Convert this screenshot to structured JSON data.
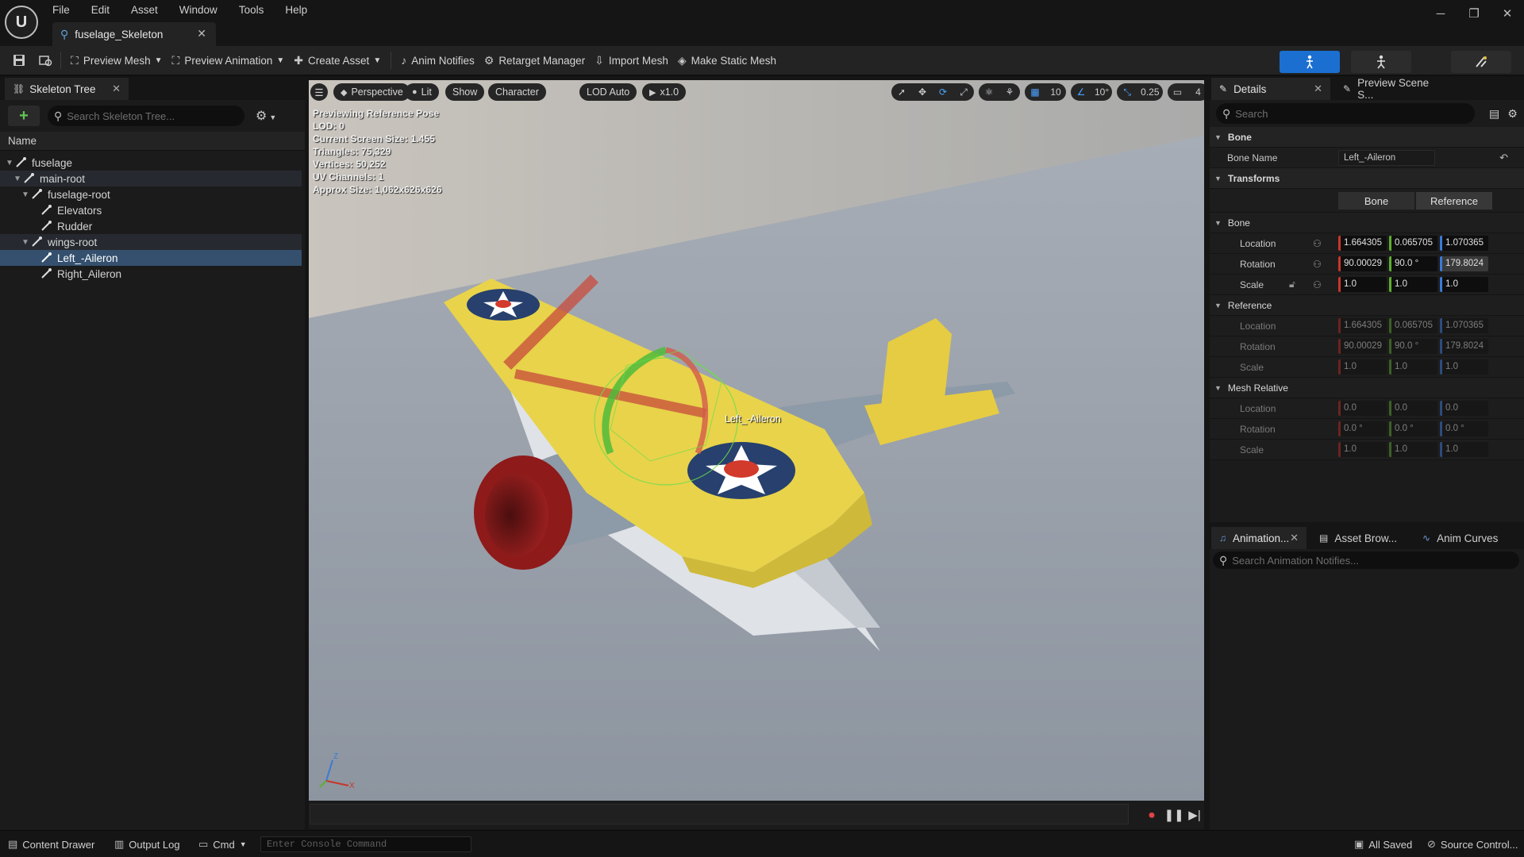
{
  "menu": [
    "File",
    "Edit",
    "Asset",
    "Window",
    "Tools",
    "Help"
  ],
  "doc_tab": {
    "title": "fuselage_Skeleton"
  },
  "toolbar": {
    "preview_mesh": "Preview Mesh",
    "preview_animation": "Preview Animation",
    "create_asset": "Create Asset",
    "anim_notifies": "Anim Notifies",
    "retarget_manager": "Retarget Manager",
    "import_mesh": "Import Mesh",
    "make_static_mesh": "Make Static Mesh"
  },
  "skeleton_tree": {
    "tab_title": "Skeleton Tree",
    "search_placeholder": "Search Skeleton Tree...",
    "column_name": "Name",
    "bones": [
      {
        "name": "fuselage"
      },
      {
        "name": "main-root"
      },
      {
        "name": "fuselage-root"
      },
      {
        "name": "Elevators"
      },
      {
        "name": "Rudder"
      },
      {
        "name": "wings-root"
      },
      {
        "name": "Left_-Aileron"
      },
      {
        "name": "Right_Aileron"
      }
    ],
    "selected": "Left_-Aileron"
  },
  "viewport": {
    "perspective": "Perspective",
    "lit": "Lit",
    "show": "Show",
    "character": "Character",
    "lod": "LOD Auto",
    "play_rate": "x1.0",
    "grid_snap": "10",
    "rot_snap": "10°",
    "scale_snap": "0.25",
    "cam_speed": "4",
    "info": [
      "Previewing Reference Pose",
      "LOD: 0",
      "Current Screen Size: 1.455",
      "Triangles: 75,329",
      "Vertices: 50,252",
      "UV Channels: 1",
      "Approx Size: 1,062x626x626"
    ],
    "bone_label": "Left_-Aileron",
    "axis_z": "Z",
    "axis_x": "X"
  },
  "details": {
    "tab_title": "Details",
    "tab2_title": "Preview Scene S...",
    "search_placeholder": "Search",
    "section_bone": "Bone",
    "bone_name_label": "Bone Name",
    "bone_name_value": "Left_-Aileron",
    "section_transforms": "Transforms",
    "toggle_bone": "Bone",
    "toggle_reference": "Reference",
    "sub_bone": "Bone",
    "sub_reference": "Reference",
    "sub_mesh_relative": "Mesh Relative",
    "lbl_location": "Location",
    "lbl_rotation": "Rotation",
    "lbl_scale": "Scale",
    "bone_location": [
      "1.664305",
      "0.065705",
      "1.070365"
    ],
    "bone_rotation": [
      "90.00029",
      "90.0 °",
      "179.8024"
    ],
    "bone_scale": [
      "1.0",
      "1.0",
      "1.0"
    ],
    "ref_location": [
      "1.664305",
      "0.065705",
      "1.070365"
    ],
    "ref_rotation": [
      "90.00029",
      "90.0 °",
      "179.8024"
    ],
    "ref_scale": [
      "1.0",
      "1.0",
      "1.0"
    ],
    "mesh_location": [
      "0.0",
      "0.0",
      "0.0"
    ],
    "mesh_rotation": [
      "0.0 °",
      "0.0 °",
      "0.0 °"
    ],
    "mesh_scale": [
      "1.0",
      "1.0",
      "1.0"
    ]
  },
  "anim_panel": {
    "tab1": "Animation...",
    "tab2": "Asset Brow...",
    "tab3": "Anim Curves",
    "search_placeholder": "Search Animation Notifies..."
  },
  "statusbar": {
    "content_drawer": "Content Drawer",
    "output_log": "Output Log",
    "cmd": "Cmd",
    "console_placeholder": "Enter Console Command",
    "all_saved": "All Saved",
    "source_control": "Source Control..."
  },
  "colors": {
    "accent_blue": "#1b6fd1",
    "selection": "#34506e",
    "add_green": "#61c553"
  }
}
